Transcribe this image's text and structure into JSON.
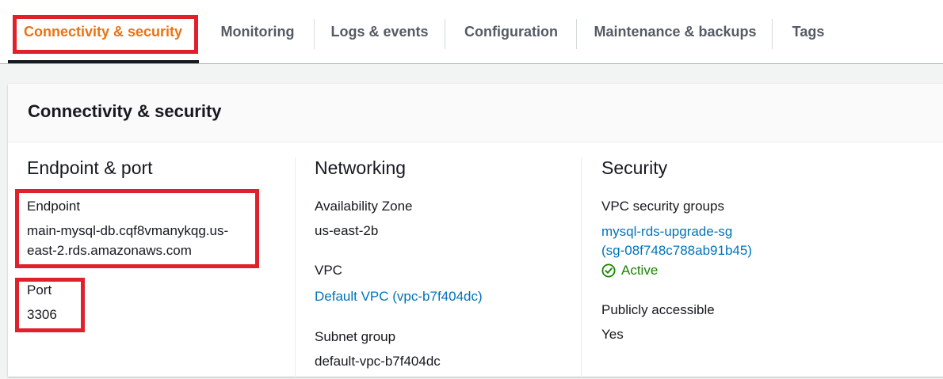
{
  "tabs": [
    {
      "label": "Connectivity & security",
      "active": true
    },
    {
      "label": "Monitoring",
      "active": false
    },
    {
      "label": "Logs & events",
      "active": false
    },
    {
      "label": "Configuration",
      "active": false
    },
    {
      "label": "Maintenance & backups",
      "active": false
    },
    {
      "label": "Tags",
      "active": false
    }
  ],
  "panel": {
    "title": "Connectivity & security",
    "endpoint_port": {
      "title": "Endpoint & port",
      "endpoint_label": "Endpoint",
      "endpoint_value_line1": "main-mysql-db.cqf8vmanykqg.us-",
      "endpoint_value_line2": "east-2.rds.amazonaws.com",
      "port_label": "Port",
      "port_value": "3306"
    },
    "networking": {
      "title": "Networking",
      "az_label": "Availability Zone",
      "az_value": "us-east-2b",
      "vpc_label": "VPC",
      "vpc_value": "Default VPC (vpc-b7f404dc)",
      "subnet_label": "Subnet group",
      "subnet_value": "default-vpc-b7f404dc"
    },
    "security": {
      "title": "Security",
      "sg_label": "VPC security groups",
      "sg_link_line1": "mysql-rds-upgrade-sg",
      "sg_link_line2": "(sg-08f748c788ab91b45)",
      "sg_status": "Active",
      "public_label": "Publicly accessible",
      "public_value": "Yes"
    }
  },
  "colors": {
    "accent": "#ec7211",
    "link": "#0073bb",
    "success": "#1d8102",
    "highlight": "#e0202a"
  },
  "icons": {
    "status": "check-circle-icon"
  }
}
